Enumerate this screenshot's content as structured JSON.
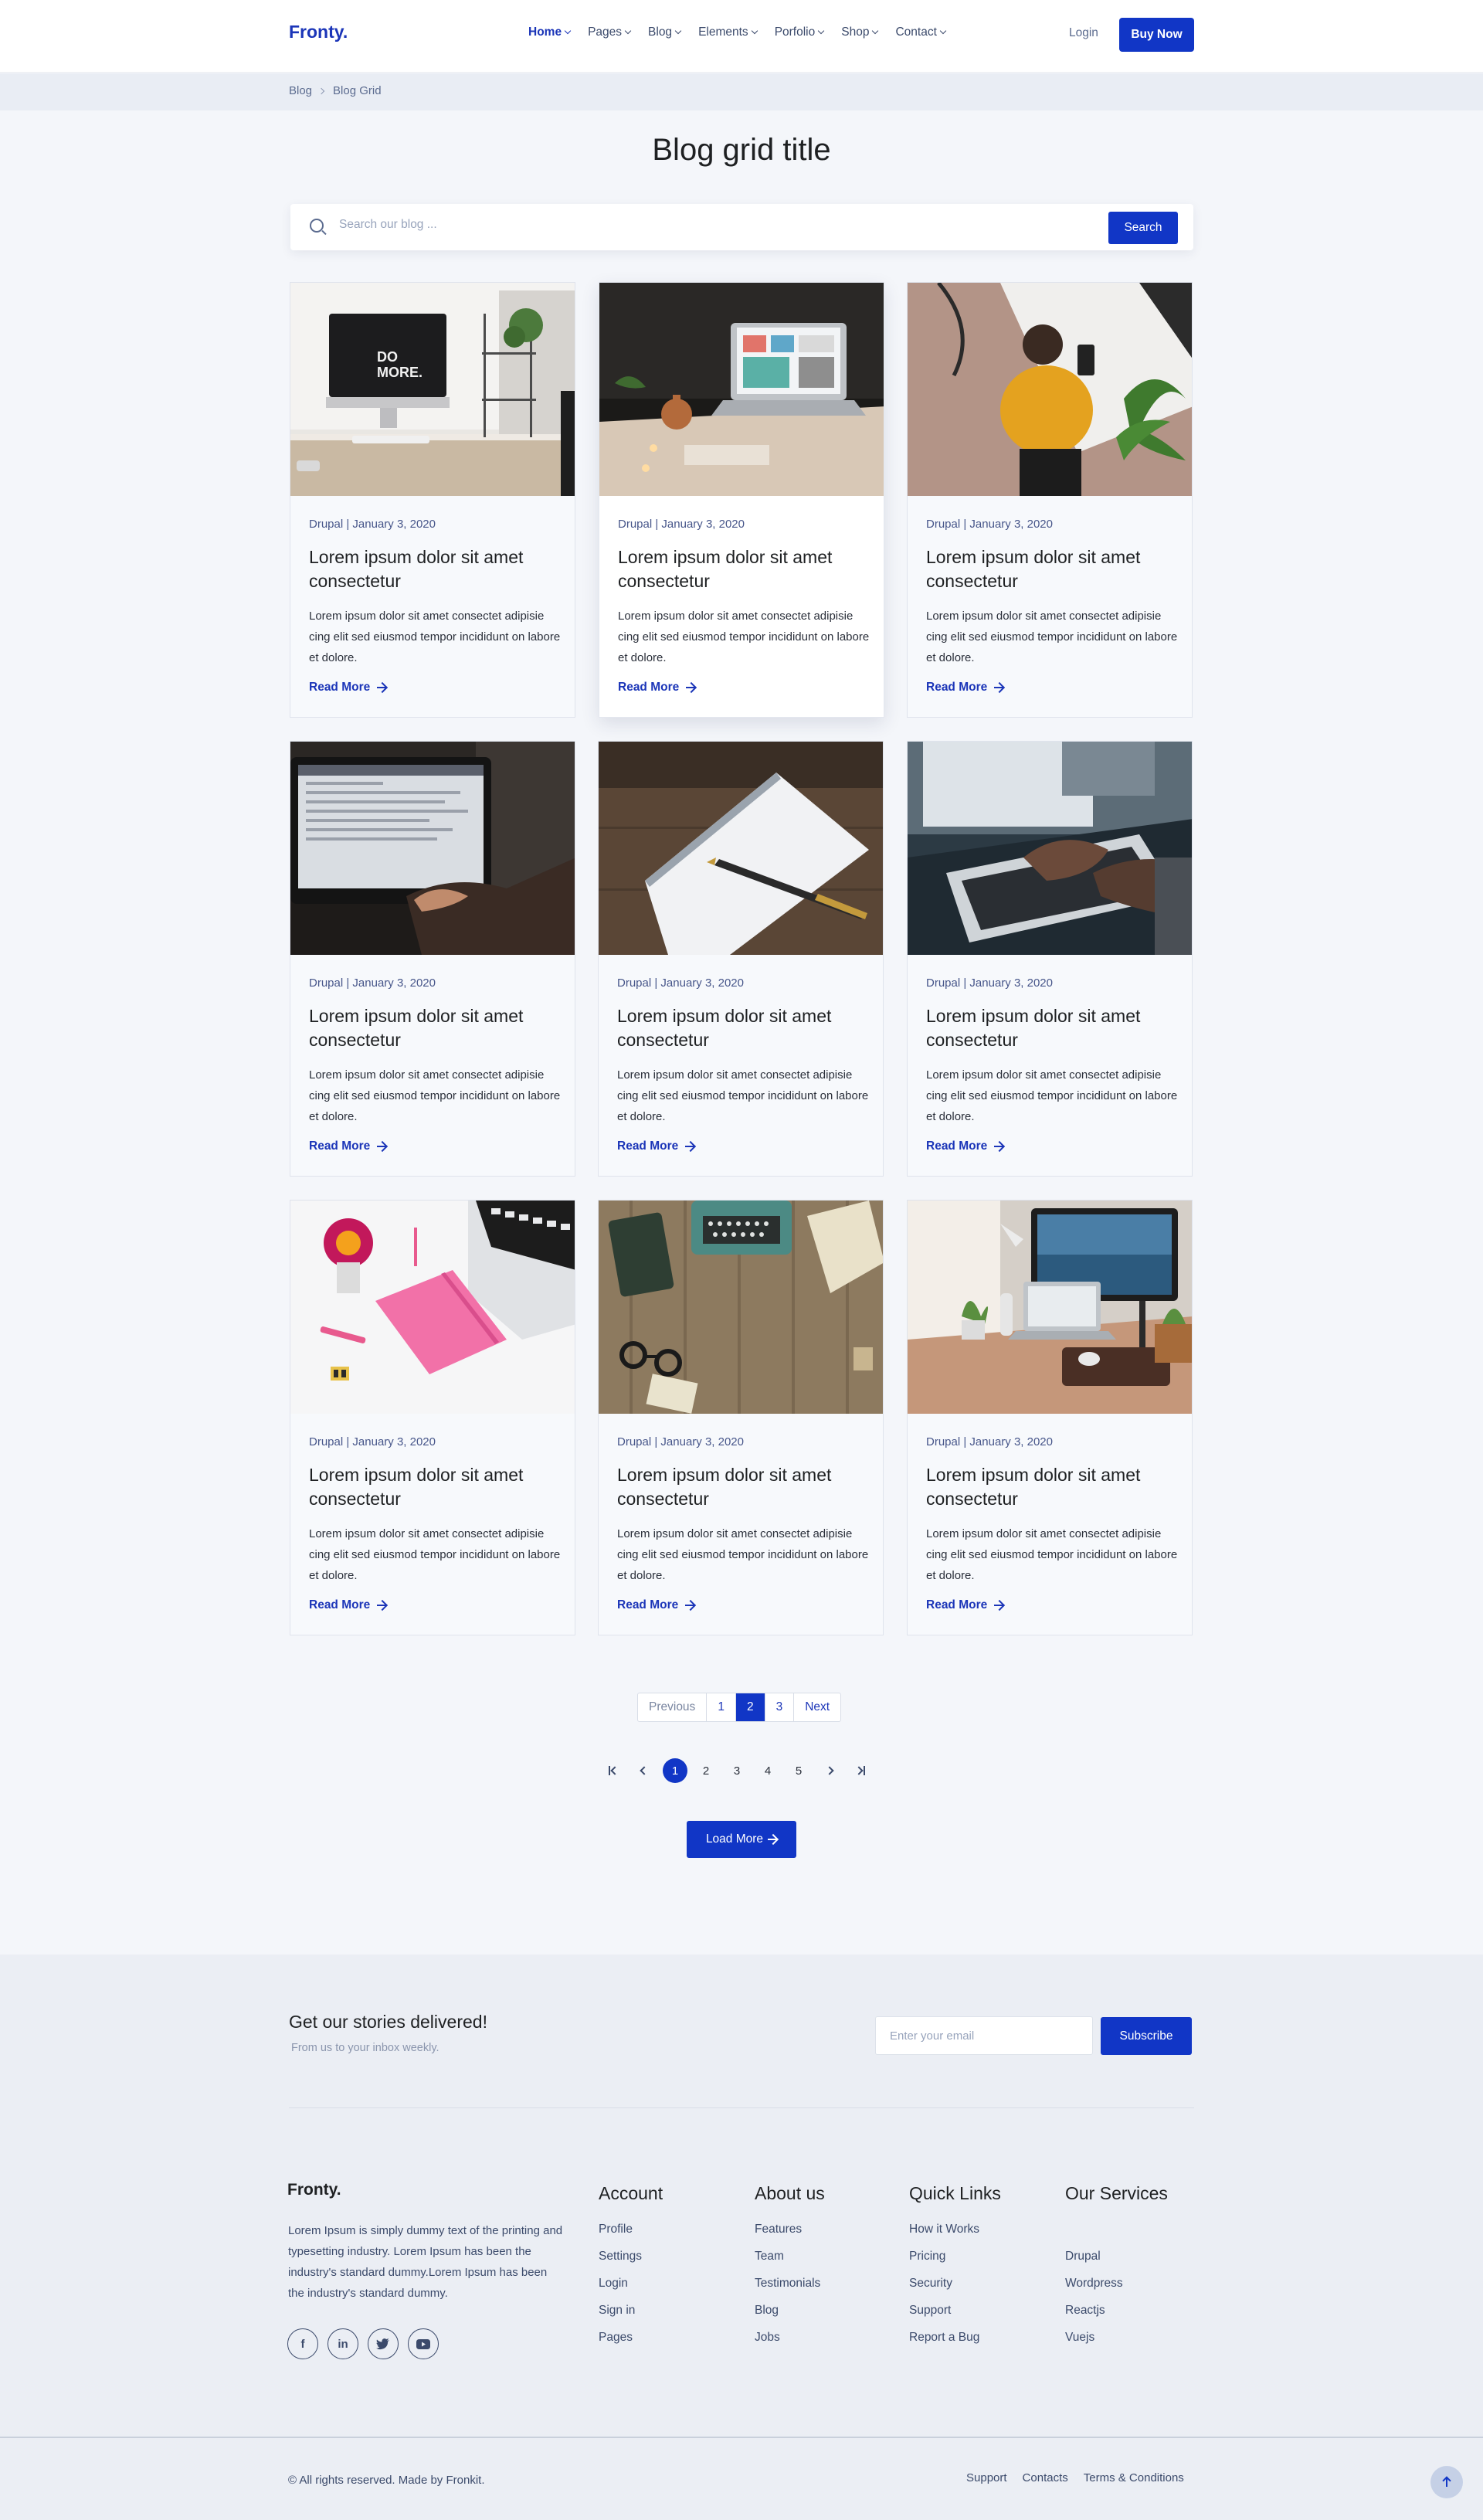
{
  "header": {
    "logo": "Fronty.",
    "nav": [
      {
        "label": "Home",
        "active": true
      },
      {
        "label": "Pages"
      },
      {
        "label": "Blog"
      },
      {
        "label": "Elements"
      },
      {
        "label": "Porfolio"
      },
      {
        "label": "Shop"
      },
      {
        "label": "Contact"
      }
    ],
    "login": "Login",
    "buy": "Buy Now"
  },
  "breadcrumb": [
    "Blog",
    "Blog Grid"
  ],
  "page_title": "Blog grid title",
  "search": {
    "placeholder": "Search our blog ...",
    "value": "",
    "button": "Search"
  },
  "posts": [
    {
      "meta": "Drupal | January 3, 2020",
      "title": "Lorem ipsum dolor sit amet consectetur",
      "excerpt": "Lorem ipsum dolor sit amet consectet adipisie cing elit sed eiusmod tempor incididunt on labore et dolore.",
      "link": "Read More",
      "image": "desk-imac-do-more"
    },
    {
      "meta": "Drupal | January 3, 2020",
      "title": "Lorem ipsum dolor sit amet consectetur",
      "excerpt": "Lorem ipsum dolor sit amet consectet adipisie cing elit sed eiusmod tempor incididunt on labore et dolore.",
      "link": "Read More",
      "image": "laptop-candles"
    },
    {
      "meta": "Drupal | January 3, 2020",
      "title": "Lorem ipsum dolor sit amet consectetur",
      "excerpt": "Lorem ipsum dolor sit amet consectet adipisie cing elit sed eiusmod tempor incididunt on labore et dolore.",
      "link": "Read More",
      "image": "woman-at-desk-top-view"
    },
    {
      "meta": "Drupal | January 3, 2020",
      "title": "Lorem ipsum dolor sit amet consectetur",
      "excerpt": "Lorem ipsum dolor sit amet consectet adipisie cing elit sed eiusmod tempor incididunt on labore et dolore.",
      "link": "Read More",
      "image": "typing-on-laptop-dark"
    },
    {
      "meta": "Drupal | January 3, 2020",
      "title": "Lorem ipsum dolor sit amet consectetur",
      "excerpt": "Lorem ipsum dolor sit amet consectet adipisie cing elit sed eiusmod tempor incididunt on labore et dolore.",
      "link": "Read More",
      "image": "notebook-fountain-pen"
    },
    {
      "meta": "Drupal | January 3, 2020",
      "title": "Lorem ipsum dolor sit amet consectetur",
      "excerpt": "Lorem ipsum dolor sit amet consectet adipisie cing elit sed eiusmod tempor incididunt on labore et dolore.",
      "link": "Read More",
      "image": "hands-typing-laptop"
    },
    {
      "meta": "Drupal | January 3, 2020",
      "title": "Lorem ipsum dolor sit amet consectetur",
      "excerpt": "Lorem ipsum dolor sit amet consectet adipisie cing elit sed eiusmod tempor incididunt on labore et dolore.",
      "link": "Read More",
      "image": "pink-notebook-flatlay"
    },
    {
      "meta": "Drupal | January 3, 2020",
      "title": "Lorem ipsum dolor sit amet consectetur",
      "excerpt": "Lorem ipsum dolor sit amet consectet adipisie cing elit sed eiusmod tempor incididunt on labore et dolore.",
      "link": "Read More",
      "image": "typewriter-wood-table"
    },
    {
      "meta": "Drupal | January 3, 2020",
      "title": "Lorem ipsum dolor sit amet consectetur",
      "excerpt": "Lorem ipsum dolor sit amet consectet adipisie cing elit sed eiusmod tempor incididunt on labore et dolore.",
      "link": "Read More",
      "image": "desk-monitor-laptop"
    }
  ],
  "pagination_a": {
    "prev": "Previous",
    "pages": [
      "1",
      "2",
      "3"
    ],
    "current": "2",
    "next": "Next"
  },
  "pagination_b": {
    "pages": [
      "1",
      "2",
      "3",
      "4",
      "5"
    ],
    "current": "1"
  },
  "load_more": "Load More",
  "newsletter": {
    "title": "Get our stories delivered!",
    "subtitle": "From us to your inbox weekly.",
    "placeholder": "Enter your email",
    "button": "Subscribe"
  },
  "footer": {
    "logo": "Fronty.",
    "about": "Lorem Ipsum is simply dummy text of the printing and typesetting industry. Lorem Ipsum has been the industry's standard dummy.Lorem Ipsum has been the industry's standard dummy.",
    "socials": [
      "facebook-icon",
      "linkedin-icon",
      "twitter-icon",
      "youtube-icon"
    ],
    "columns": [
      {
        "title": "Account",
        "links": [
          "Profile",
          "Settings",
          "Login",
          "Sign in",
          "Pages"
        ]
      },
      {
        "title": "About us",
        "links": [
          "Features",
          "Team",
          "Testimonials",
          "Blog",
          "Jobs"
        ]
      },
      {
        "title": "Quick Links",
        "links": [
          "How it Works",
          "Pricing",
          "Security",
          "Support",
          "Report a Bug"
        ]
      },
      {
        "title": "Our Services",
        "links": [
          "",
          "Drupal",
          "Wordpress",
          "Reactjs",
          "Vuejs"
        ]
      }
    ],
    "copyright": "© All rights reserved. Made by Fronkit.",
    "bottom_links": [
      "Support",
      "Contacts",
      "Terms & Conditions"
    ]
  },
  "colors": {
    "accent": "#1136c6",
    "brand_text": "#1b35b8",
    "page_bg": "#f4f6fa"
  }
}
